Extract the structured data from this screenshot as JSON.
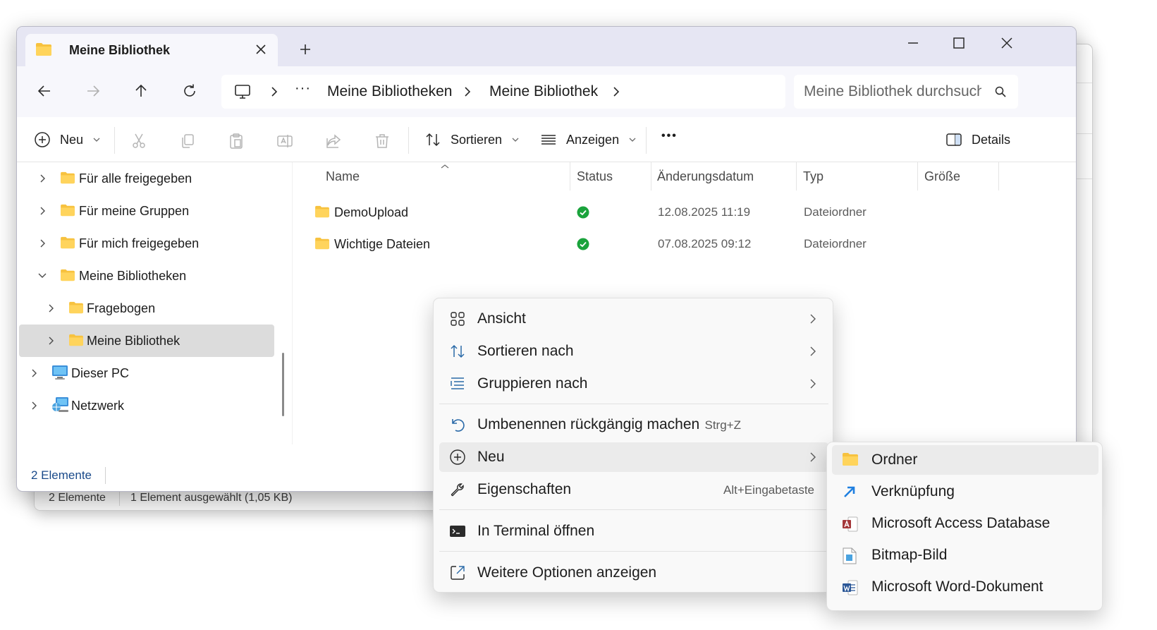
{
  "window": {
    "tab_title": "Meine Bibliothek",
    "breadcrumbs": [
      "Meine Bibliotheken",
      "Meine Bibliothek"
    ],
    "search_placeholder": "Meine Bibliothek durchsuchen"
  },
  "toolbar": {
    "new_label": "Neu",
    "sort_label": "Sortieren",
    "view_label": "Anzeigen",
    "more_label": "•••",
    "details_label": "Details"
  },
  "nav": [
    {
      "label": "Für alle freigegeben",
      "icon": "folder-icon",
      "expanded": false
    },
    {
      "label": "Für meine Gruppen",
      "icon": "folder-icon",
      "expanded": false
    },
    {
      "label": "Für mich freigegeben",
      "icon": "folder-icon",
      "expanded": false
    },
    {
      "label": "Meine Bibliotheken",
      "icon": "folder-icon",
      "expanded": true
    },
    {
      "label": "Fragebogen",
      "icon": "folder-icon",
      "expanded": false
    },
    {
      "label": "Meine Bibliothek",
      "icon": "folder-icon",
      "expanded": false,
      "selected": true
    },
    {
      "label": "Dieser PC",
      "icon": "pc-icon",
      "expanded": false
    },
    {
      "label": "Netzwerk",
      "icon": "network-icon",
      "expanded": false
    }
  ],
  "columns": [
    "Name",
    "Status",
    "Änderungsdatum",
    "Typ",
    "Größe"
  ],
  "files": [
    {
      "name": "DemoUpload",
      "status": "synced",
      "date": "12.08.2025 11:19",
      "type": "Dateiordner"
    },
    {
      "name": "Wichtige Dateien",
      "status": "synced",
      "date": "07.08.2025 09:12",
      "type": "Dateiordner"
    }
  ],
  "statusbar": {
    "count": "2 Elemente"
  },
  "background_window": {
    "count": "2 Elemente",
    "selection": "1 Element ausgewählt (1,05 KB)"
  },
  "context_menu": {
    "items": [
      {
        "label": "Ansicht",
        "icon": "grid-icon",
        "submenu": true
      },
      {
        "label": "Sortieren nach",
        "icon": "sort-icon",
        "submenu": true
      },
      {
        "label": "Gruppieren nach",
        "icon": "group-icon",
        "submenu": true
      },
      {
        "label": "Umbenennen rückgängig machen",
        "icon": "undo-icon",
        "accelerator": "Strg+Z"
      },
      {
        "label": "Neu",
        "icon": "add-circle-icon",
        "submenu": true,
        "hover": true
      },
      {
        "label": "Eigenschaften",
        "icon": "wrench-icon",
        "accelerator": "Alt+Eingabetaste"
      },
      {
        "label": "In Terminal öffnen",
        "icon": "terminal-icon"
      },
      {
        "label": "Weitere Optionen anzeigen",
        "icon": "open-external-icon"
      }
    ]
  },
  "submenu_new": {
    "items": [
      {
        "label": "Ordner",
        "icon": "folder-icon"
      },
      {
        "label": "Verknüpfung",
        "icon": "shortcut-icon"
      },
      {
        "label": "Microsoft Access Database",
        "icon": "access-icon"
      },
      {
        "label": "Bitmap-Bild",
        "icon": "bitmap-icon"
      },
      {
        "label": "Microsoft Word-Dokument",
        "icon": "word-icon"
      }
    ]
  },
  "colors": {
    "folder": "#f7c23f",
    "accent": "#1a4a8a",
    "status_ok": "#1aa33c",
    "selection": "#dcdcdc",
    "titlebar": "#e6e6f3"
  }
}
